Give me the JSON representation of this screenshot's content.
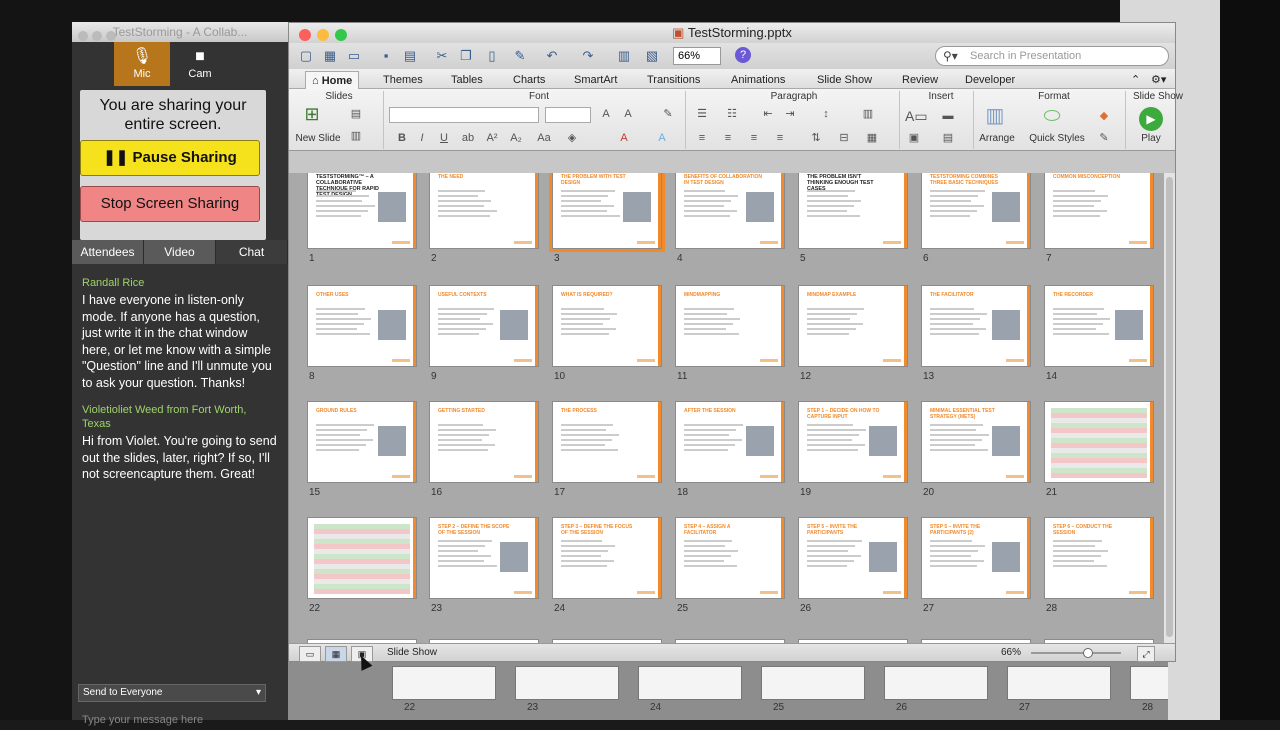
{
  "gtm": {
    "title": "TestStorming - A Collab...",
    "mic_label": "Mic",
    "cam_label": "Cam",
    "share_msg": "You are sharing your entire screen.",
    "pause_label": "Pause Sharing",
    "stop_label": "Stop Screen Sharing",
    "tabs": [
      "Attendees",
      "Video",
      "Chat"
    ],
    "chat": [
      {
        "from": "Randall Rice",
        "text": "I have everyone in listen-only mode. If anyone has a question, just write it in the chat window here, or let me know with a simple \"Question\" line and I'll unmute you to ask your question. Thanks!"
      },
      {
        "from": "Violetioliet Weed from Fort Worth, Texas",
        "text": "Hi from Violet. You're going to send out the slides, later, right? If so, I'll not screencapture them. Great!"
      }
    ],
    "send_to": "Send to Everyone",
    "message_placeholder": "Type your message here"
  },
  "ppt": {
    "title": "TestStorming.pptx",
    "zoom": "66%",
    "search_placeholder": "Search in Presentation",
    "ribbon_tabs": [
      "Home",
      "Themes",
      "Tables",
      "Charts",
      "SmartArt",
      "Transitions",
      "Animations",
      "Slide Show",
      "Review",
      "Developer"
    ],
    "groups": [
      "Slides",
      "Font",
      "Paragraph",
      "Insert",
      "Format",
      "Slide Show"
    ],
    "new_slide": "New Slide",
    "arrange": "Arrange",
    "quick_styles": "Quick Styles",
    "play": "Play",
    "status_view": "Slide Show",
    "status_zoom": "66%"
  },
  "slides": [
    {
      "n": "1",
      "title": "TESTSTORMING™ – A COLLABORATIVE TECHNIQUE FOR RAPID TEST DESIGN"
    },
    {
      "n": "2",
      "title": "THE NEED"
    },
    {
      "n": "3",
      "title": "THE PROBLEM WITH TEST DESIGN"
    },
    {
      "n": "4",
      "title": "BENEFITS OF COLLABORATION IN TEST DESIGN"
    },
    {
      "n": "5",
      "title": "The problem isn't thinking enough test cases"
    },
    {
      "n": "6",
      "title": "TESTSTORMING COMBINES THREE BASIC TECHNIQUES"
    },
    {
      "n": "7",
      "title": "COMMON MISCONCEPTION"
    },
    {
      "n": "8",
      "title": "OTHER USES"
    },
    {
      "n": "9",
      "title": "USEFUL CONTEXTS"
    },
    {
      "n": "10",
      "title": "WHAT IS REQUIRED?"
    },
    {
      "n": "11",
      "title": "MINDMAPPING"
    },
    {
      "n": "12",
      "title": "MINDMAP EXAMPLE"
    },
    {
      "n": "13",
      "title": "THE FACILITATOR"
    },
    {
      "n": "14",
      "title": "THE RECORDER"
    },
    {
      "n": "15",
      "title": "GROUND RULES"
    },
    {
      "n": "16",
      "title": "GETTING STARTED"
    },
    {
      "n": "17",
      "title": "THE PROCESS"
    },
    {
      "n": "18",
      "title": "AFTER THE SESSION"
    },
    {
      "n": "19",
      "title": "STEP 1 – DECIDE ON HOW TO CAPTURE INPUT"
    },
    {
      "n": "20",
      "title": "MINIMAL ESSENTIAL TEST STRATEGY (METS)"
    },
    {
      "n": "21",
      "title": ""
    },
    {
      "n": "22",
      "title": ""
    },
    {
      "n": "23",
      "title": "STEP 2 – DEFINE THE SCOPE OF THE SESSION"
    },
    {
      "n": "24",
      "title": "STEP 3 – DEFINE THE FOCUS OF THE SESSION"
    },
    {
      "n": "25",
      "title": "STEP 4 – ASSIGN A FACILITATOR"
    },
    {
      "n": "26",
      "title": "STEP 5 – INVITE THE PARTICIPANTS"
    },
    {
      "n": "27",
      "title": "STEP 5 – INVITE THE PARTICIPANTS (2)"
    },
    {
      "n": "28",
      "title": "STEP 6 – CONDUCT THE SESSION"
    }
  ],
  "bg_numbers": [
    "22",
    "23",
    "24",
    "25",
    "26",
    "27",
    "28"
  ],
  "colors": {
    "accent": "#f08a2c",
    "pause": "#f5e11c",
    "stop": "#f08585",
    "chat_name": "#9ed36a"
  }
}
